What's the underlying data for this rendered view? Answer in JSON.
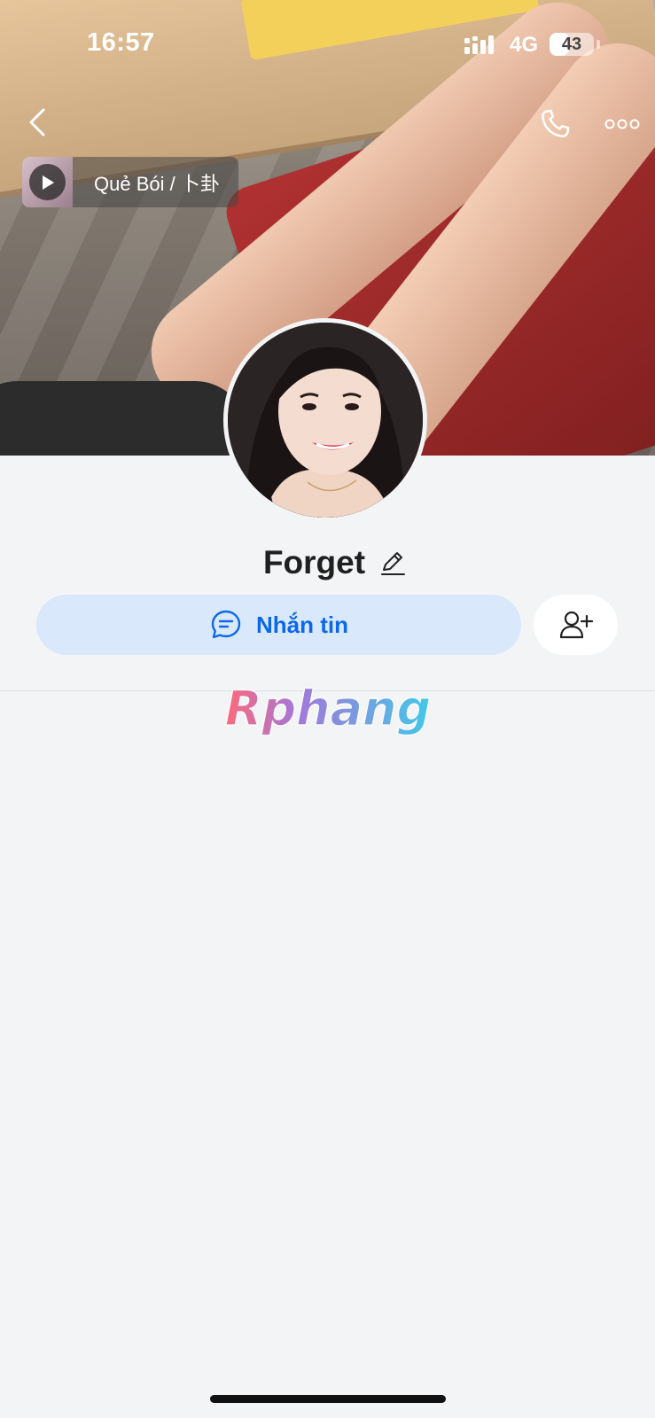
{
  "status_bar": {
    "time": "16:57",
    "network": "4G",
    "battery_level": "43",
    "battery_fraction": 0.43
  },
  "icons": {
    "back": "chevron-left-icon",
    "call": "phone-icon",
    "more": "more-horizontal-icon",
    "play": "play-icon",
    "edit": "pencil-icon",
    "chat": "chat-bubble-icon",
    "add_friend": "user-plus-icon"
  },
  "music": {
    "title": "Quẻ Bói / 卜卦"
  },
  "profile": {
    "name": "Forget"
  },
  "actions": {
    "message_label": "Nhắn tin"
  },
  "watermark": {
    "text": "Rphang"
  },
  "colors": {
    "accent": "#0b68e8",
    "button_bg": "#dae8fc",
    "page_bg": "#f3f4f6"
  }
}
